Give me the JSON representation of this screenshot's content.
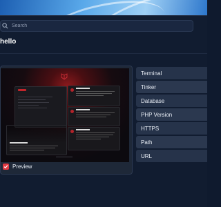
{
  "search": {
    "placeholder": "Search"
  },
  "page": {
    "title": "hello"
  },
  "preview": {
    "label": "Preview",
    "checked": true
  },
  "menu": {
    "items": [
      {
        "label": "Terminal"
      },
      {
        "label": "Tinker"
      },
      {
        "label": "Database"
      },
      {
        "label": "PHP Version"
      },
      {
        "label": "HTTPS"
      },
      {
        "label": "Path"
      },
      {
        "label": "URL"
      }
    ]
  },
  "colors": {
    "accent": "#e23a42",
    "window_bg": "#111c30",
    "menu_item_bg": "#26334a"
  },
  "icons": {
    "search": "search-icon",
    "check": "check-icon",
    "logo": "laravel-logo-icon"
  }
}
